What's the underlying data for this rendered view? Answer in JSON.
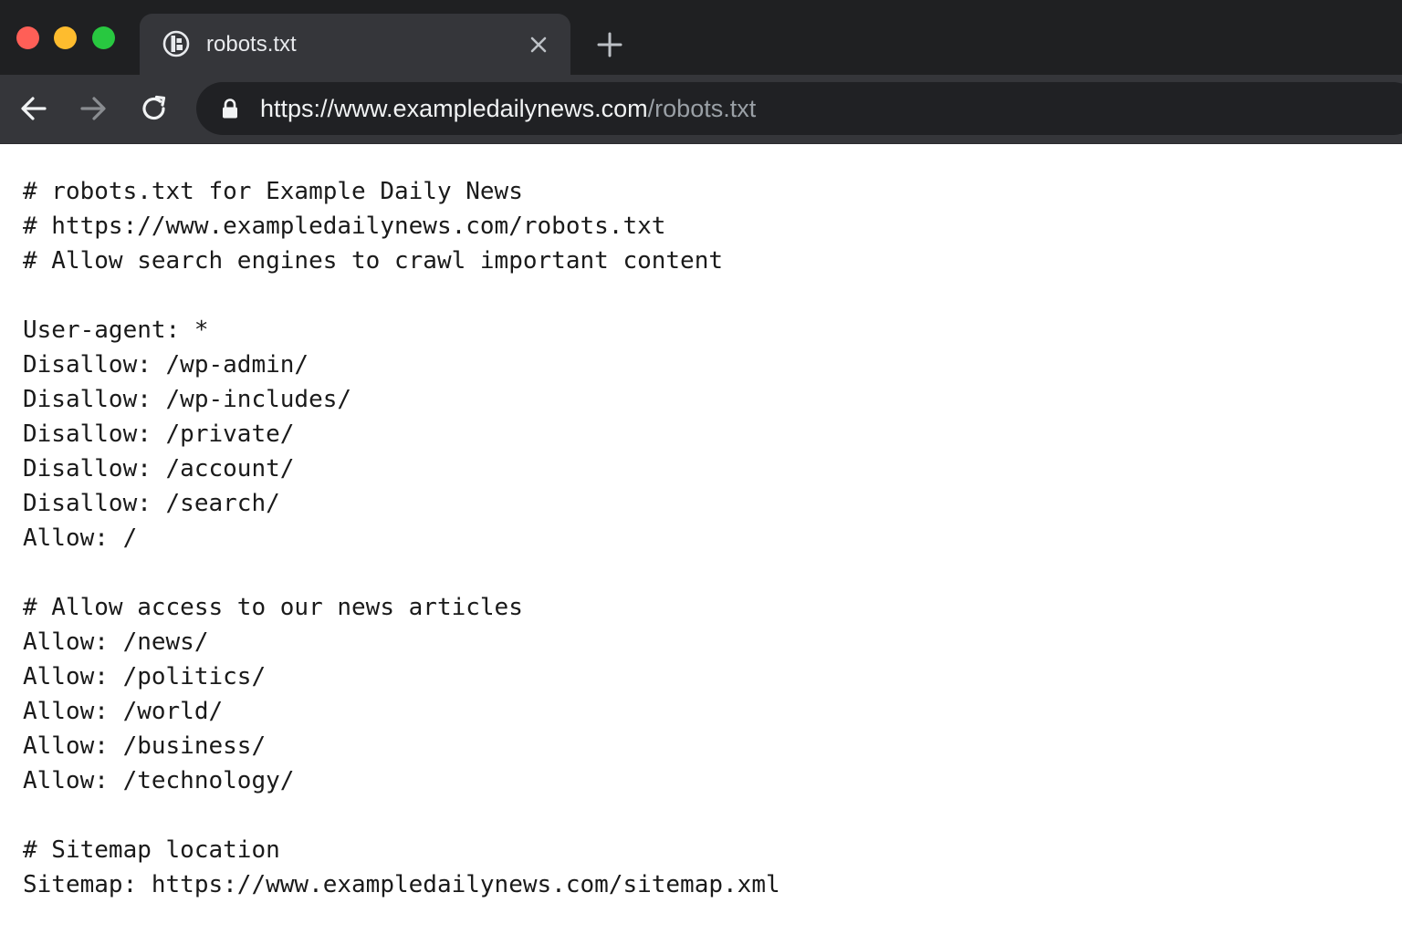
{
  "window": {
    "controls": {
      "close_color": "#ff5f57",
      "minimize_color": "#febc2e",
      "maximize_color": "#28c840"
    }
  },
  "tab": {
    "title": "robots.txt",
    "favicon": "site-favicon-icon",
    "close_icon": "close-icon"
  },
  "new_tab_icon": "plus-icon",
  "toolbar": {
    "back_icon": "arrow-left-icon",
    "forward_icon": "arrow-right-icon",
    "reload_icon": "reload-icon"
  },
  "address_bar": {
    "lock_icon": "lock-icon",
    "url_host": "https://www.exampledailynews.com",
    "url_path": "/robots.txt"
  },
  "document": {
    "lines": [
      "# robots.txt for Example Daily News",
      "# https://www.exampledailynews.com/robots.txt",
      "# Allow search engines to crawl important content",
      "",
      "User-agent: *",
      "Disallow: /wp-admin/",
      "Disallow: /wp-includes/",
      "Disallow: /private/",
      "Disallow: /account/",
      "Disallow: /search/",
      "Allow: /",
      "",
      "# Allow access to our news articles",
      "Allow: /news/",
      "Allow: /politics/",
      "Allow: /world/",
      "Allow: /business/",
      "Allow: /technology/",
      "",
      "# Sitemap location",
      "Sitemap: https://www.exampledailynews.com/sitemap.xml"
    ]
  }
}
